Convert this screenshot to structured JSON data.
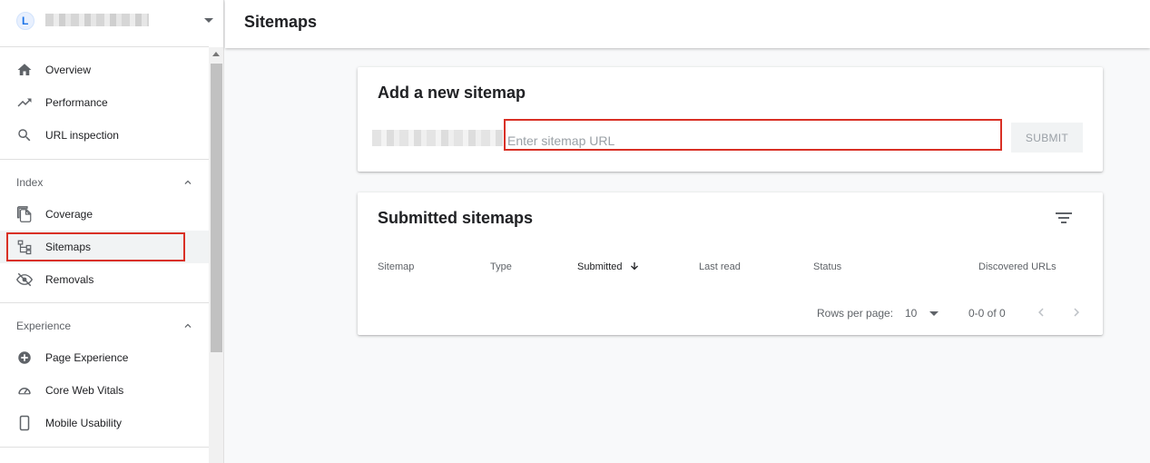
{
  "property": {
    "logo_letter": "L"
  },
  "sidebar": {
    "top_items": [
      {
        "label": "Overview",
        "icon": "home-icon"
      },
      {
        "label": "Performance",
        "icon": "trending-up-icon"
      },
      {
        "label": "URL inspection",
        "icon": "search-icon"
      }
    ],
    "index": {
      "label": "Index",
      "items": [
        {
          "label": "Coverage",
          "icon": "copy-icon"
        },
        {
          "label": "Sitemaps",
          "icon": "sitemap-icon"
        },
        {
          "label": "Removals",
          "icon": "visibility-off-icon"
        }
      ]
    },
    "experience": {
      "label": "Experience",
      "items": [
        {
          "label": "Page Experience",
          "icon": "add-circle-icon"
        },
        {
          "label": "Core Web Vitals",
          "icon": "speed-gauge-icon"
        },
        {
          "label": "Mobile Usability",
          "icon": "smartphone-icon"
        }
      ]
    }
  },
  "header": {
    "title": "Sitemaps"
  },
  "add_sitemap": {
    "title": "Add a new sitemap",
    "input_placeholder": "Enter sitemap URL",
    "submit_label": "SUBMIT"
  },
  "submitted": {
    "title": "Submitted sitemaps",
    "columns": [
      "Sitemap",
      "Type",
      "Submitted",
      "Last read",
      "Status",
      "Discovered URLs"
    ],
    "sorted_column": "Submitted",
    "rows_per_page_label": "Rows per page:",
    "rows_per_page_value": "10",
    "range_label": "0-0 of 0"
  },
  "colors": {
    "highlight": "#d93025",
    "active_bg": "#f1f3f4"
  }
}
